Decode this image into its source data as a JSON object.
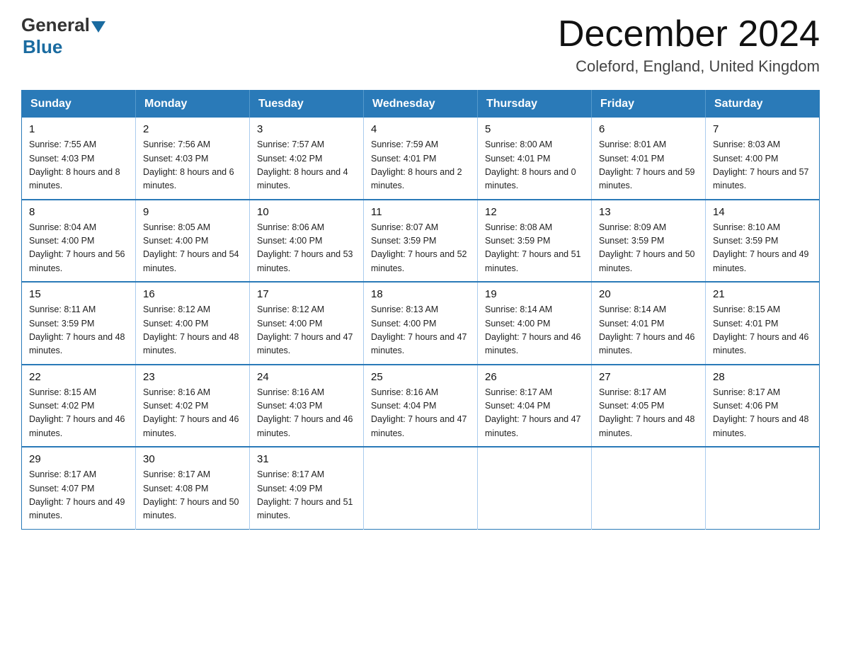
{
  "header": {
    "logo_general": "General",
    "logo_blue": "Blue",
    "month_title": "December 2024",
    "location": "Coleford, England, United Kingdom"
  },
  "days_of_week": [
    "Sunday",
    "Monday",
    "Tuesday",
    "Wednesday",
    "Thursday",
    "Friday",
    "Saturday"
  ],
  "weeks": [
    [
      {
        "day": "1",
        "sunrise": "7:55 AM",
        "sunset": "4:03 PM",
        "daylight": "8 hours and 8 minutes."
      },
      {
        "day": "2",
        "sunrise": "7:56 AM",
        "sunset": "4:03 PM",
        "daylight": "8 hours and 6 minutes."
      },
      {
        "day": "3",
        "sunrise": "7:57 AM",
        "sunset": "4:02 PM",
        "daylight": "8 hours and 4 minutes."
      },
      {
        "day": "4",
        "sunrise": "7:59 AM",
        "sunset": "4:01 PM",
        "daylight": "8 hours and 2 minutes."
      },
      {
        "day": "5",
        "sunrise": "8:00 AM",
        "sunset": "4:01 PM",
        "daylight": "8 hours and 0 minutes."
      },
      {
        "day": "6",
        "sunrise": "8:01 AM",
        "sunset": "4:01 PM",
        "daylight": "7 hours and 59 minutes."
      },
      {
        "day": "7",
        "sunrise": "8:03 AM",
        "sunset": "4:00 PM",
        "daylight": "7 hours and 57 minutes."
      }
    ],
    [
      {
        "day": "8",
        "sunrise": "8:04 AM",
        "sunset": "4:00 PM",
        "daylight": "7 hours and 56 minutes."
      },
      {
        "day": "9",
        "sunrise": "8:05 AM",
        "sunset": "4:00 PM",
        "daylight": "7 hours and 54 minutes."
      },
      {
        "day": "10",
        "sunrise": "8:06 AM",
        "sunset": "4:00 PM",
        "daylight": "7 hours and 53 minutes."
      },
      {
        "day": "11",
        "sunrise": "8:07 AM",
        "sunset": "3:59 PM",
        "daylight": "7 hours and 52 minutes."
      },
      {
        "day": "12",
        "sunrise": "8:08 AM",
        "sunset": "3:59 PM",
        "daylight": "7 hours and 51 minutes."
      },
      {
        "day": "13",
        "sunrise": "8:09 AM",
        "sunset": "3:59 PM",
        "daylight": "7 hours and 50 minutes."
      },
      {
        "day": "14",
        "sunrise": "8:10 AM",
        "sunset": "3:59 PM",
        "daylight": "7 hours and 49 minutes."
      }
    ],
    [
      {
        "day": "15",
        "sunrise": "8:11 AM",
        "sunset": "3:59 PM",
        "daylight": "7 hours and 48 minutes."
      },
      {
        "day": "16",
        "sunrise": "8:12 AM",
        "sunset": "4:00 PM",
        "daylight": "7 hours and 48 minutes."
      },
      {
        "day": "17",
        "sunrise": "8:12 AM",
        "sunset": "4:00 PM",
        "daylight": "7 hours and 47 minutes."
      },
      {
        "day": "18",
        "sunrise": "8:13 AM",
        "sunset": "4:00 PM",
        "daylight": "7 hours and 47 minutes."
      },
      {
        "day": "19",
        "sunrise": "8:14 AM",
        "sunset": "4:00 PM",
        "daylight": "7 hours and 46 minutes."
      },
      {
        "day": "20",
        "sunrise": "8:14 AM",
        "sunset": "4:01 PM",
        "daylight": "7 hours and 46 minutes."
      },
      {
        "day": "21",
        "sunrise": "8:15 AM",
        "sunset": "4:01 PM",
        "daylight": "7 hours and 46 minutes."
      }
    ],
    [
      {
        "day": "22",
        "sunrise": "8:15 AM",
        "sunset": "4:02 PM",
        "daylight": "7 hours and 46 minutes."
      },
      {
        "day": "23",
        "sunrise": "8:16 AM",
        "sunset": "4:02 PM",
        "daylight": "7 hours and 46 minutes."
      },
      {
        "day": "24",
        "sunrise": "8:16 AM",
        "sunset": "4:03 PM",
        "daylight": "7 hours and 46 minutes."
      },
      {
        "day": "25",
        "sunrise": "8:16 AM",
        "sunset": "4:04 PM",
        "daylight": "7 hours and 47 minutes."
      },
      {
        "day": "26",
        "sunrise": "8:17 AM",
        "sunset": "4:04 PM",
        "daylight": "7 hours and 47 minutes."
      },
      {
        "day": "27",
        "sunrise": "8:17 AM",
        "sunset": "4:05 PM",
        "daylight": "7 hours and 48 minutes."
      },
      {
        "day": "28",
        "sunrise": "8:17 AM",
        "sunset": "4:06 PM",
        "daylight": "7 hours and 48 minutes."
      }
    ],
    [
      {
        "day": "29",
        "sunrise": "8:17 AM",
        "sunset": "4:07 PM",
        "daylight": "7 hours and 49 minutes."
      },
      {
        "day": "30",
        "sunrise": "8:17 AM",
        "sunset": "4:08 PM",
        "daylight": "7 hours and 50 minutes."
      },
      {
        "day": "31",
        "sunrise": "8:17 AM",
        "sunset": "4:09 PM",
        "daylight": "7 hours and 51 minutes."
      },
      null,
      null,
      null,
      null
    ]
  ]
}
